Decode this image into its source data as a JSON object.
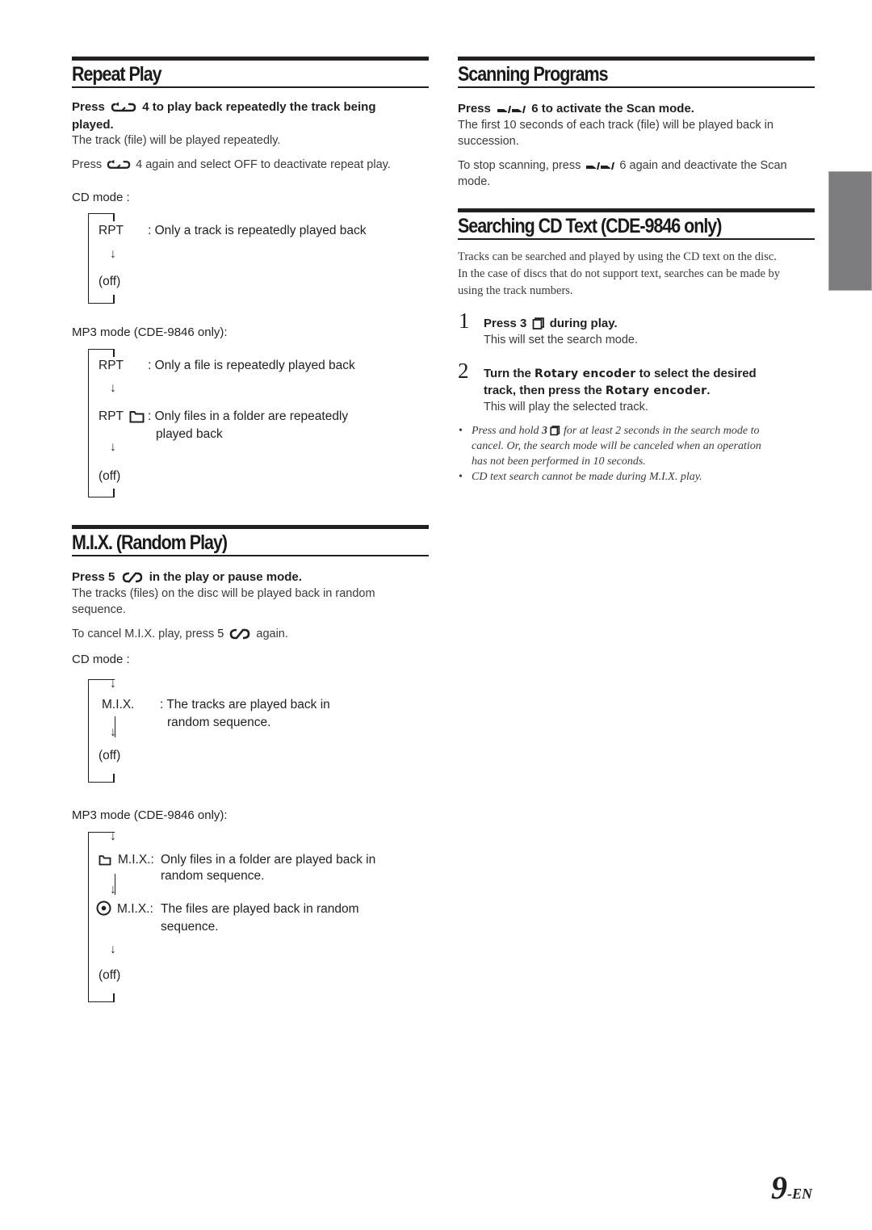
{
  "repeat_play": {
    "title": "Repeat Play",
    "instruction_prefix": "Press",
    "instruction_suffix_l1": "4 to play back repeatedly the track being",
    "instruction_suffix_l2": "played.",
    "desc": "The track (file) will be played repeatedly.",
    "deactivate_prefix": "Press",
    "deactivate_suffix": "4 again and select OFF to deactivate repeat play.",
    "cd_mode_label": "CD mode :",
    "cd_diagram": {
      "item1_label": "RPT",
      "item1_desc": ": Only a track is repeatedly played back",
      "arrow": "↓",
      "off": "(off)"
    },
    "mp3_mode_label": "MP3 mode (CDE-9846 only):",
    "mp3_diagram": {
      "item1_label": "RPT",
      "item1_desc": ": Only a file is repeatedly played back",
      "item2_label": "RPT",
      "item2_desc_l1": ": Only files in a folder are repeatedly",
      "item2_desc_l2": "played back",
      "arrow": "↓",
      "off": "(off)"
    }
  },
  "mix": {
    "title": "M.I.X. (Random Play)",
    "instruction_prefix": "Press 5",
    "instruction_suffix": "in the play or pause mode.",
    "desc_l1": "The tracks (files) on the disc will be played back in random",
    "desc_l2": "sequence.",
    "cancel_prefix": "To cancel M.I.X. play, press",
    "cancel_key": "5",
    "cancel_suffix": "again.",
    "cd_mode_label": "CD mode :",
    "cd_diagram": {
      "item1_label": "M.I.X.",
      "item1_desc_l1": ": The tracks are played back in",
      "item1_desc_l2": "random sequence.",
      "arrow": "↓",
      "off": "(off)"
    },
    "mp3_mode_label": "MP3 mode (CDE-9846 only):",
    "mp3_diagram": {
      "item1_label": "M.I.X.:",
      "item1_desc_l1": "Only files in a folder are played back in",
      "item1_desc_l2": "random sequence.",
      "item2_label": "M.I.X.:",
      "item2_desc_l1": "The files are played back in random",
      "item2_desc_l2": "sequence.",
      "arrow": "↓",
      "off": "(off)"
    }
  },
  "scanning": {
    "title": "Scanning Programs",
    "instruction_prefix": "Press",
    "instruction_suffix": "6 to activate the Scan mode.",
    "desc_l1": "The first 10 seconds of each track (file) will be played back in",
    "desc_l2": "succession.",
    "stop_prefix": "To stop scanning, press",
    "stop_suffix": "6 again and deactivate the Scan",
    "stop_l2": "mode."
  },
  "cd_text": {
    "title": "Searching CD Text (CDE-9846 only)",
    "intro_l1": "Tracks can be searched and played by using the CD text on the disc.",
    "intro_l2": "In the case of discs that do not support text, searches can be made by",
    "intro_l3": "using the track numbers.",
    "steps": [
      {
        "num": "1",
        "title_prefix": "Press 3",
        "title_suffix": "during play.",
        "desc": "This will set the search mode."
      },
      {
        "num": "2",
        "title_l1_a": "Turn the ",
        "title_l1_b": "Rotary encoder",
        "title_l1_c": " to select the desired",
        "title_l2_a": "track, then press the ",
        "title_l2_b": "Rotary encoder",
        "title_l2_c": ".",
        "desc": "This will play the selected track."
      }
    ],
    "notes": [
      {
        "bullet": "•",
        "l1_prefix": "Press and hold ",
        "l1_key": "3",
        "l1_suffix": " for at least 2 seconds in the search mode to",
        "l2": "cancel. Or, the search mode will be canceled when an operation",
        "l3": "has not been performed in 10 seconds."
      },
      {
        "bullet": "•",
        "l1": "CD text search cannot be made during M.I.X. play."
      }
    ]
  },
  "footer": {
    "page_number": "9",
    "page_suffix": "-EN"
  },
  "icons": {
    "repeat": "repeat-icon",
    "scan": "scan-icon",
    "mix": "mix-icon",
    "search": "search-icon",
    "folder": "folder-icon",
    "disc": "disc-icon"
  },
  "colors": {
    "text": "#231f20",
    "body_text": "#3a3a3a",
    "thumb_tab": "#7d7d7f"
  }
}
